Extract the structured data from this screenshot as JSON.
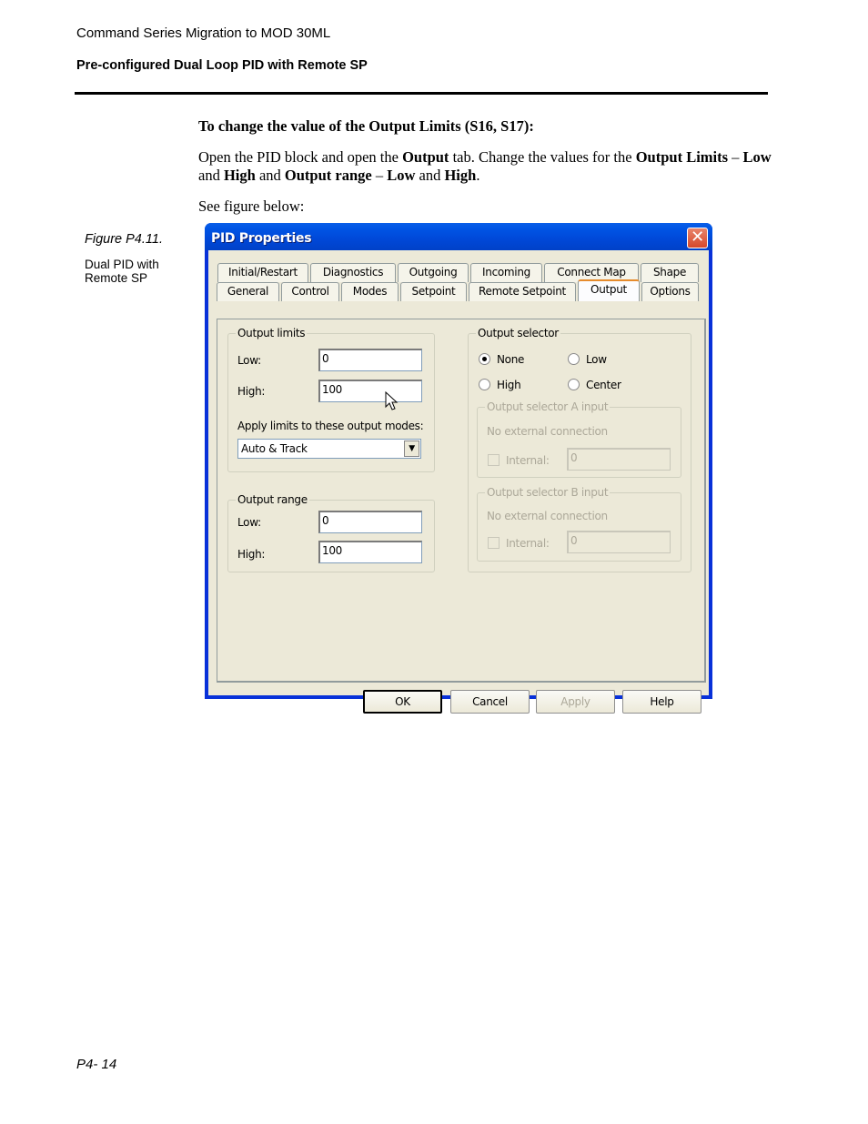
{
  "page": {
    "header_title": "Command Series Migration to MOD 30ML",
    "section_title": "Pre-configured Dual Loop PID with Remote SP",
    "instruction_heading": "To change the value of the Output Limits (S16, S17):",
    "instruction_body": [
      {
        "text": "Open the PID block and open the ",
        "bold": false
      },
      {
        "text": "Output",
        "bold": true
      },
      {
        "text": " tab. Change the values for the ",
        "bold": false
      },
      {
        "text": "Output Limits",
        "bold": true
      },
      {
        "text": " – ",
        "bold": false
      },
      {
        "text": "Low",
        "bold": true
      },
      {
        "text": " and ",
        "bold": false
      },
      {
        "text": "High",
        "bold": true
      },
      {
        "text": " and ",
        "bold": false
      },
      {
        "text": "Output range",
        "bold": true
      },
      {
        "text": " – ",
        "bold": false
      },
      {
        "text": "Low",
        "bold": true
      },
      {
        "text": " and ",
        "bold": false
      },
      {
        "text": "High",
        "bold": true
      },
      {
        "text": ".",
        "bold": false
      }
    ],
    "see_figure": "See figure below:",
    "figure_caption": "Figure P4.11.",
    "figure_description": "Dual PID with Remote SP",
    "page_number": "P4- 14"
  },
  "dialog": {
    "title": "PID Properties",
    "close_glyph": "✕",
    "tabs_row1": [
      "Initial/Restart",
      "Diagnostics",
      "Outgoing",
      "Incoming",
      "Connect Map",
      "Shape"
    ],
    "tabs_row2": [
      "General",
      "Control",
      "Modes",
      "Setpoint",
      "Remote Setpoint",
      "Output",
      "Options"
    ],
    "active_tab": "Output",
    "output_limits": {
      "legend": "Output limits",
      "low_label": "Low:",
      "low_value": "0",
      "high_label": "High:",
      "high_value": "100",
      "apply_label": "Apply limits to these output modes:",
      "apply_selected": "Auto & Track"
    },
    "output_range": {
      "legend": "Output range",
      "low_label": "Low:",
      "low_value": "0",
      "high_label": "High:",
      "high_value": "100"
    },
    "output_selector": {
      "legend": "Output selector",
      "options": [
        "None",
        "Low",
        "High",
        "Center"
      ],
      "selected": "None",
      "input_a": {
        "legend": "Output selector A input",
        "status": "No external connection",
        "internal_label": "Internal:",
        "internal_checked": false,
        "internal_value": "0"
      },
      "input_b": {
        "legend": "Output selector B input",
        "status": "No external connection",
        "internal_label": "Internal:",
        "internal_checked": false,
        "internal_value": "0"
      }
    },
    "buttons": {
      "ok": "OK",
      "cancel": "Cancel",
      "apply": "Apply",
      "help": "Help"
    },
    "colors": {
      "title_bar": "#0055e5",
      "face": "#ece9d8",
      "active_tab_accent": "#e68b2c",
      "close_button": "#d5482a",
      "disabled_text": "#aca899"
    }
  }
}
